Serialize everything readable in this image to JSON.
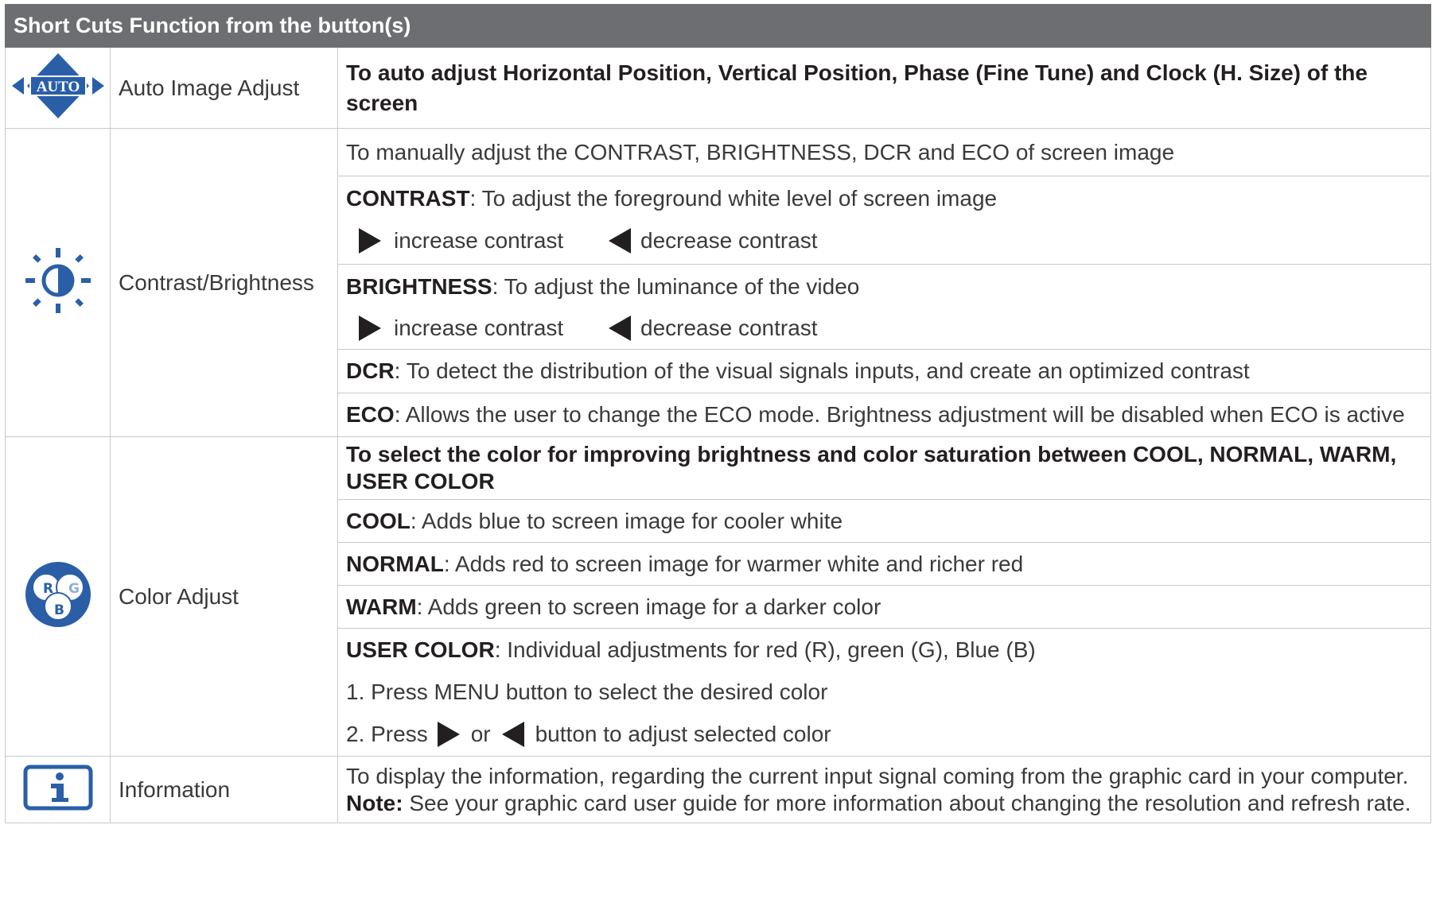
{
  "header": {
    "title": "Short Cuts Function from the button(s)"
  },
  "rows": {
    "auto": {
      "icon": "auto-icon",
      "icon_text": "AUTO",
      "name": "Auto Image Adjust",
      "desc": "To auto adjust Horizontal Position, Vertical Position, Phase (Fine Tune) and Clock (H. Size) of the screen"
    },
    "contrast": {
      "icon": "sun-contrast-icon",
      "name": "Contrast/Brightness",
      "intro": "To manually adjust the CONTRAST, BRIGHTNESS, DCR and ECO of screen image",
      "contrast_key": "CONTRAST",
      "contrast_desc": ": To adjust the foreground white level of screen image",
      "increase": "increase contrast",
      "decrease": "decrease contrast",
      "brightness_key": "BRIGHTNESS",
      "brightness_desc": ": To adjust the luminance of the video",
      "increase2": "increase contrast",
      "decrease2": "decrease contrast",
      "dcr_key": "DCR",
      "dcr_desc": ": To detect the distribution of the visual signals inputs, and create an optimized contrast",
      "eco_key": "ECO",
      "eco_desc": ": Allows the user to change the ECO mode. Brightness adjustment will be disabled when ECO is active"
    },
    "color": {
      "icon": "rgb-icon",
      "icon_r": "R",
      "icon_g": "G",
      "icon_b": "B",
      "name": "Color Adjust",
      "intro": "To select the color for improving brightness and color saturation between COOL, NORMAL, WARM, USER COLOR",
      "cool_key": "COOL",
      "cool_desc": ": Adds blue to screen image for cooler white",
      "normal_key": "NORMAL",
      "normal_desc": ": Adds red to screen image for warmer white and richer red",
      "warm_key": "WARM",
      "warm_desc": ": Adds green to screen image for a darker color",
      "user_key": "USER COLOR",
      "user_desc": ": Individual adjustments for red (R), green (G), Blue (B)",
      "step1": "1. Press MENU button to select the desired color",
      "step2_a": "2. Press",
      "step2_or": "or",
      "step2_b": "button to adjust selected color"
    },
    "info": {
      "icon": "info-icon",
      "name": "Information",
      "desc": "To display the information, regarding the current input signal coming from the graphic card in your computer.",
      "note_key": "Note:",
      "note_desc": " See your graphic card user guide for more information about changing the resolution and refresh rate."
    }
  },
  "colors": {
    "header_bg": "#6d6e71",
    "icon_blue": "#2a5fa8",
    "icon_light": "#8fb0dc"
  }
}
